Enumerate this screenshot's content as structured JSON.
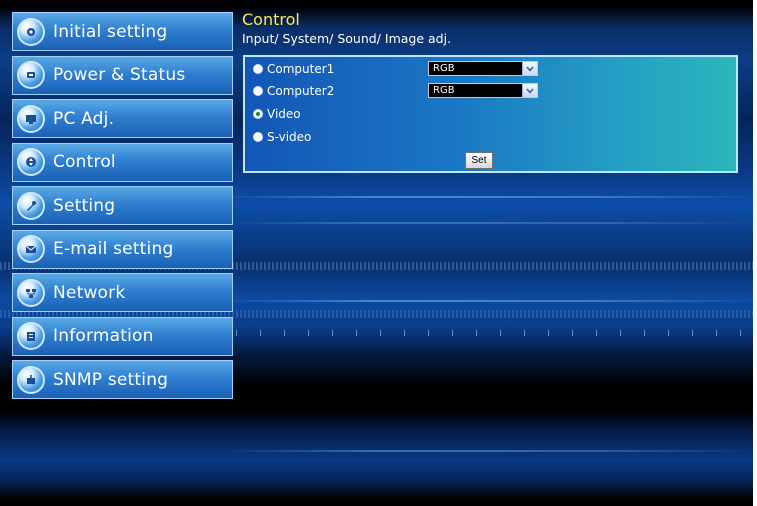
{
  "colors": {
    "title": "#ffe84a",
    "nav_gradient_top": "#5aa9e6",
    "nav_gradient_bottom": "#1b61b6",
    "panel_left": "#1356b7",
    "panel_right": "#2bb6bb"
  },
  "sidebar": {
    "items": [
      {
        "label": "Initial setting",
        "icon": "initial-setting-icon"
      },
      {
        "label": "Power & Status",
        "icon": "power-status-icon"
      },
      {
        "label": "PC Adj.",
        "icon": "pc-adj-icon"
      },
      {
        "label": "Control",
        "icon": "control-icon"
      },
      {
        "label": "Setting",
        "icon": "setting-icon"
      },
      {
        "label": "E-mail setting",
        "icon": "email-icon"
      },
      {
        "label": "Network",
        "icon": "network-icon"
      },
      {
        "label": "Information",
        "icon": "information-icon"
      },
      {
        "label": "SNMP setting",
        "icon": "snmp-icon"
      }
    ]
  },
  "header": {
    "title": "Control",
    "subtitle": "Input/ System/ Sound/ Image adj."
  },
  "panel": {
    "options": [
      {
        "label": "Computer1",
        "selected": false,
        "select_value": "RGB"
      },
      {
        "label": "Computer2",
        "selected": false,
        "select_value": "RGB"
      },
      {
        "label": "Video",
        "selected": true
      },
      {
        "label": "S-video",
        "selected": false
      }
    ],
    "set_label": "Set"
  }
}
